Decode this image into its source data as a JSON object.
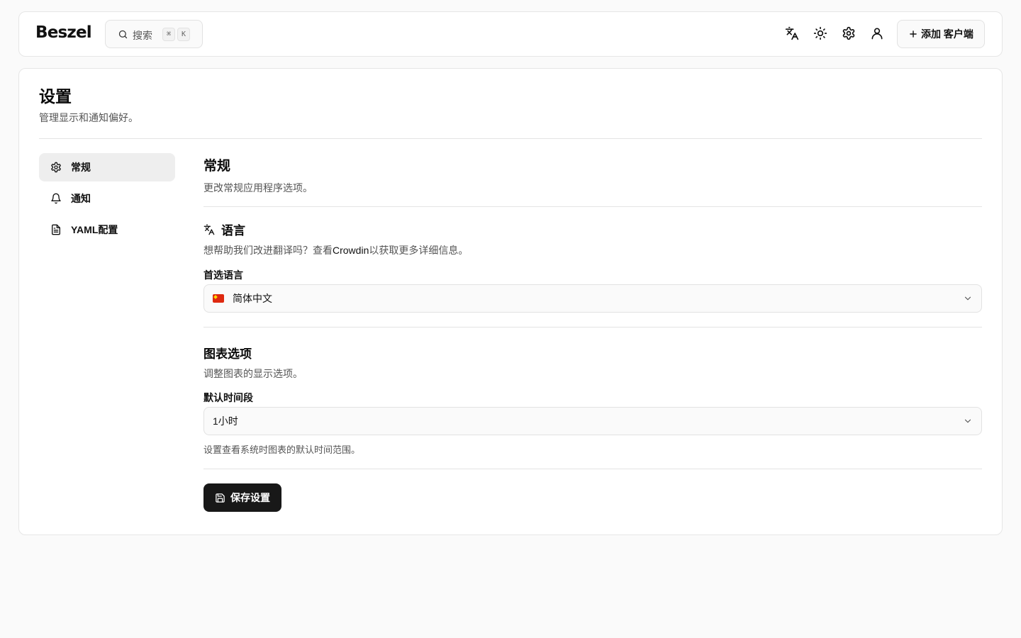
{
  "header": {
    "logo": "Beszel",
    "search": {
      "label": "搜索",
      "shortcut_keys": [
        "⌘",
        "K"
      ]
    },
    "icons": [
      "language-icon",
      "theme-sun-icon",
      "settings-gear-icon",
      "user-icon"
    ],
    "add_client_label": "添加 客户端"
  },
  "page": {
    "title": "设置",
    "subtitle": "管理显示和通知偏好。"
  },
  "sidebar": {
    "items": [
      {
        "label": "常规",
        "icon": "gear-icon",
        "active": true
      },
      {
        "label": "通知",
        "icon": "bell-icon",
        "active": false
      },
      {
        "label": "YAML配置",
        "icon": "file-icon",
        "active": false
      }
    ]
  },
  "general": {
    "title": "常规",
    "description": "更改常规应用程序选项。"
  },
  "language": {
    "title": "语言",
    "help_prefix": "想帮助我们改进翻译吗？查看",
    "help_link": "Crowdin",
    "help_suffix": "以获取更多详细信息。",
    "field_label": "首选语言",
    "selected": "简体中文"
  },
  "chart_options": {
    "title": "图表选项",
    "description": "调整图表的显示选项。",
    "field_label": "默认时间段",
    "selected": "1小时",
    "hint": "设置查看系统时图表的默认时间范围。"
  },
  "save_label": "保存设置",
  "colors": {
    "background": "#fafafa",
    "card": "#ffffff",
    "primary_button": "#181818",
    "active_nav": "#eeeeee"
  }
}
